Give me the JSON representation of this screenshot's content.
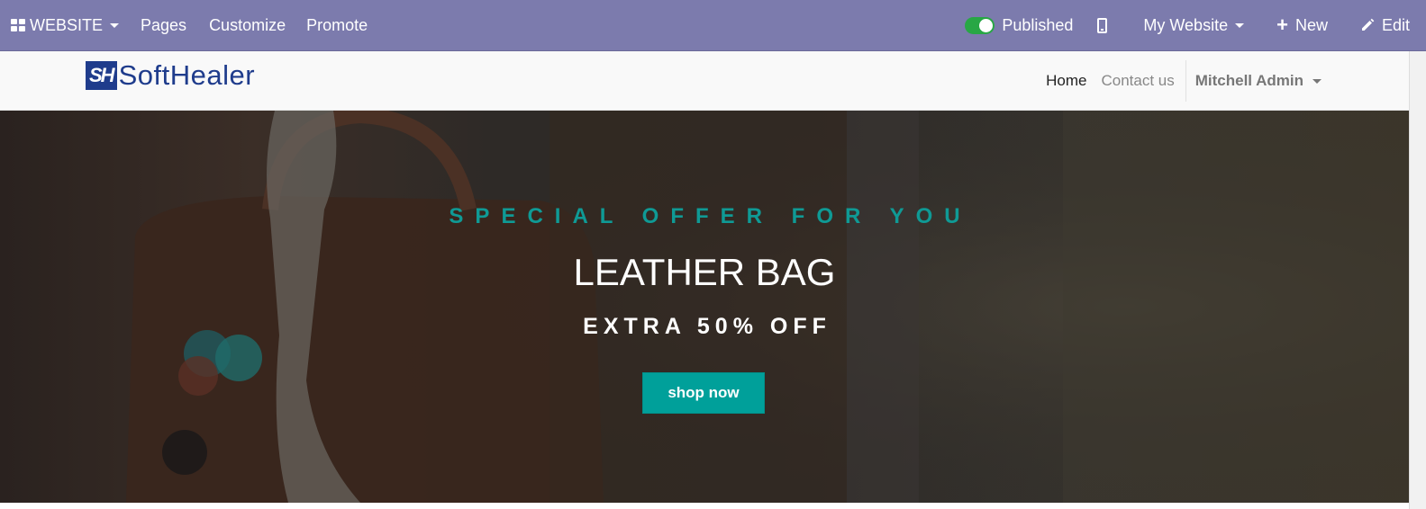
{
  "admin_bar": {
    "app_label": "WEBSITE",
    "menu": [
      "Pages",
      "Customize",
      "Promote"
    ],
    "published_label": "Published",
    "website_label": "My Website",
    "new_label": "New",
    "edit_label": "Edit",
    "bar_color": "#7c7bad",
    "toggle_color": "#28a745"
  },
  "site_header": {
    "logo_mark": "SH",
    "logo_text": "SoftHealer",
    "nav": [
      "Home",
      "Contact us"
    ],
    "user": "Mitchell Admin"
  },
  "hero": {
    "kicker": "SPECIAL OFFER FOR YOU",
    "title": "LEATHER BAG",
    "subtitle": "EXTRA 50% OFF",
    "button_label": "shop now",
    "accent_color": "#00a09a"
  }
}
